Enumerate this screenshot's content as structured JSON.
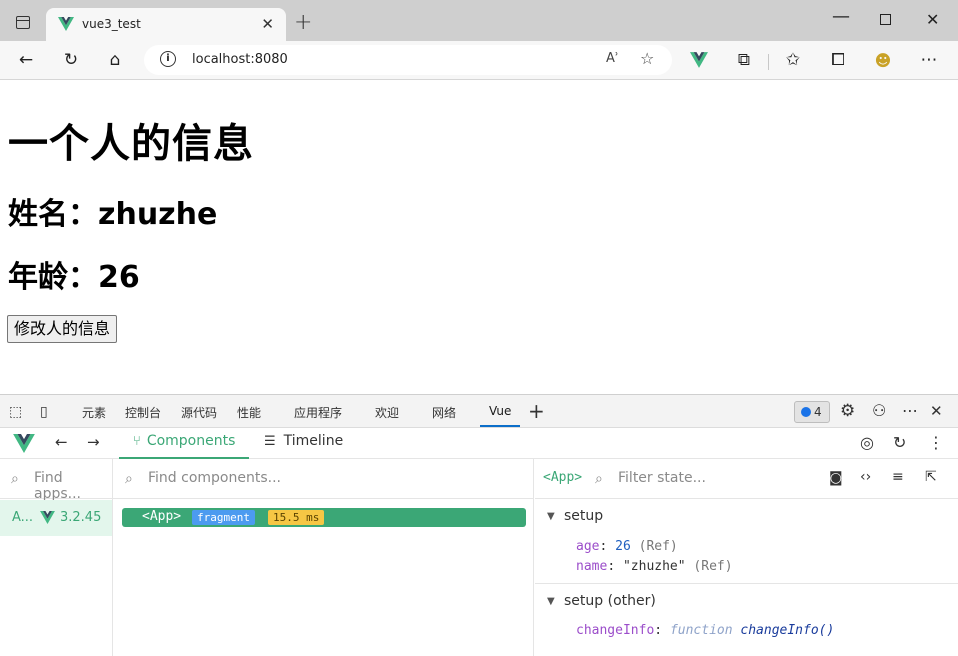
{
  "browser": {
    "tab_title": "vue3_test",
    "address": "localhost:8080",
    "read_aloud_label": "Aʾ"
  },
  "page": {
    "heading": "一个人的信息",
    "name_line": "姓名：zhuzhe",
    "age_line": "年龄：26",
    "button_label": "修改人的信息"
  },
  "devtools": {
    "tabs": [
      "元素",
      "控制台",
      "源代码",
      "性能",
      "应用程序",
      "欢迎",
      "网络",
      "Vue"
    ],
    "active_tab": "Vue",
    "issues_count": "4",
    "vue": {
      "components_tab": "Components",
      "timeline_tab": "Timeline",
      "apps_search_placeholder": "Find apps...",
      "components_search_placeholder": "Find components...",
      "state_search_placeholder": "Filter state...",
      "selected_component": "<App>",
      "app_item": {
        "label": "A...",
        "version": "3.2.45"
      },
      "tree_row": {
        "tag": "<App>",
        "badge": "fragment",
        "time": "15.5 ms"
      },
      "sections": {
        "setup": {
          "title": "setup",
          "props": [
            {
              "key": "age",
              "value": "26",
              "kind": "(Ref)"
            },
            {
              "key": "name",
              "value": "\"zhuzhe\"",
              "kind": "(Ref)"
            }
          ]
        },
        "setup_other": {
          "title": "setup (other)",
          "props": [
            {
              "key": "changeInfo",
              "keyword": "function",
              "value": "changeInfo()"
            }
          ]
        }
      }
    }
  },
  "colors": {
    "vue_green": "#3ba776",
    "fragment_blue": "#4c9bf0",
    "timing_yellow": "#f6c744",
    "edge_blue": "#0b6ec9"
  }
}
